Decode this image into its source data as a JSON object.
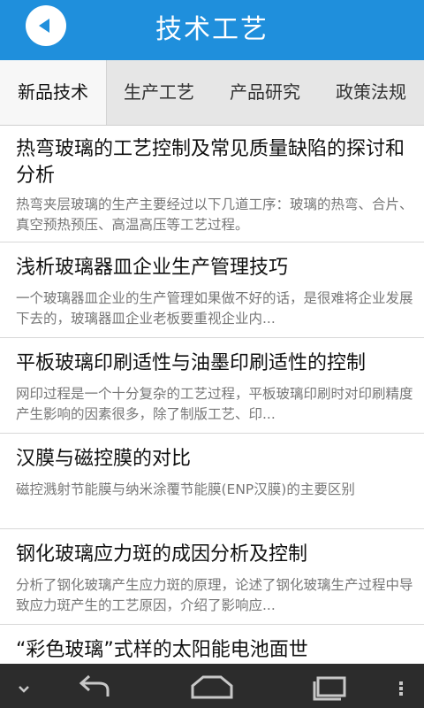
{
  "header": {
    "title": "技术工艺",
    "back_icon": "back-arrow-icon"
  },
  "tabs": [
    {
      "label": "新品技术"
    },
    {
      "label": "生产工艺"
    },
    {
      "label": "产品研究"
    },
    {
      "label": "政策法规"
    }
  ],
  "articles": [
    {
      "title": "热弯玻璃的工艺控制及常见质量缺陷的探讨和分析",
      "summary": "热弯夹层玻璃的生产主要经过以下几道工序：玻璃的热弯、合片、真空预热预压、高温高压等工艺过程。"
    },
    {
      "title": "浅析玻璃器皿企业生产管理技巧",
      "summary": "一个玻璃器皿企业的生产管理如果做不好的话，是很难将企业发展下去的，玻璃器皿企业老板要重视企业内..."
    },
    {
      "title": "平板玻璃印刷适性与油墨印刷适性的控制",
      "summary": "网印过程是一个十分复杂的工艺过程，平板玻璃印刷时对印刷精度产生影响的因素很多，除了制版工艺、印..."
    },
    {
      "title": "汉膜与磁控膜的对比",
      "summary": "磁控溅射节能膜与纳米涂覆节能膜(ENP汉膜)的主要区别"
    },
    {
      "title": "钢化玻璃应力斑的成因分析及控制",
      "summary": "分析了钢化玻璃产生应力斑的原理，论述了钢化玻璃生产过程中导致应力斑产生的工艺原因，介绍了影响应..."
    },
    {
      "title": "“彩色玻璃”式样的太阳能电池面世",
      "summary": ""
    }
  ],
  "navbar": {
    "icons": [
      "chevron-down-icon",
      "back-icon",
      "home-icon",
      "recent-apps-icon",
      "menu-icon"
    ]
  },
  "colors": {
    "header": "#1f8fdc",
    "tabbar": "#e6e6e6",
    "navbar": "#2c2c2c"
  }
}
